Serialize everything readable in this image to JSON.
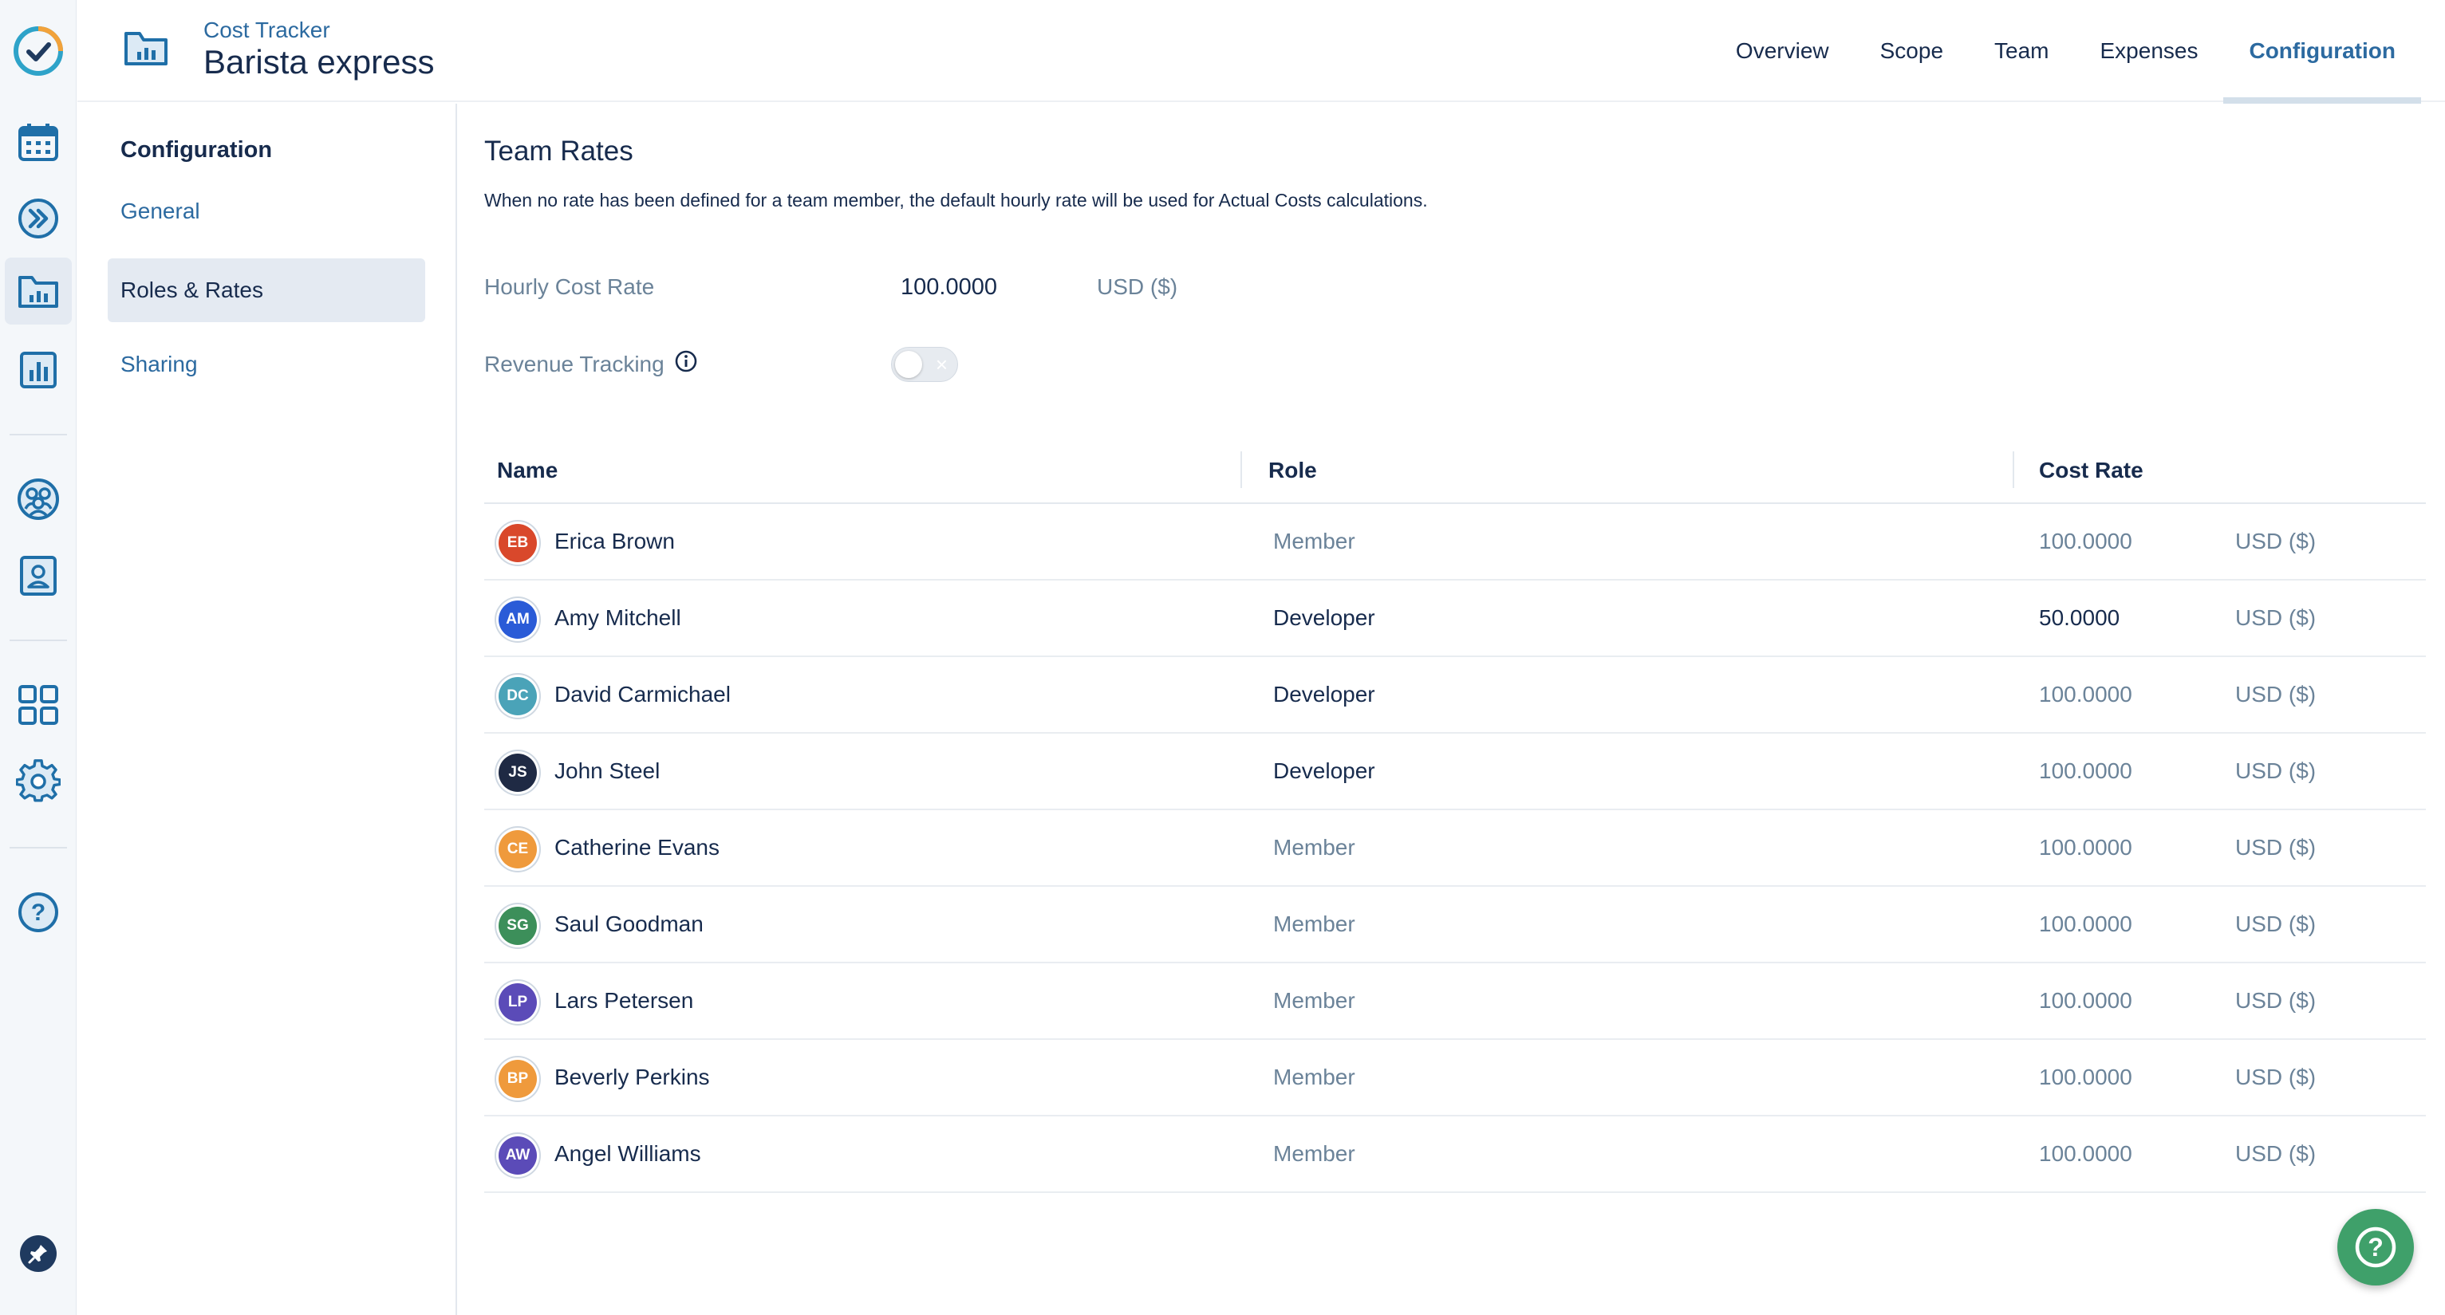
{
  "header": {
    "subtitle": "Cost Tracker",
    "title": "Barista express",
    "tabs": [
      {
        "label": "Overview",
        "active": false
      },
      {
        "label": "Scope",
        "active": false
      },
      {
        "label": "Team",
        "active": false
      },
      {
        "label": "Expenses",
        "active": false
      },
      {
        "label": "Configuration",
        "active": true
      }
    ]
  },
  "config_nav": {
    "heading": "Configuration",
    "items": [
      {
        "label": "General",
        "active": false
      },
      {
        "label": "Roles & Rates",
        "active": true
      },
      {
        "label": "Sharing",
        "active": false
      }
    ]
  },
  "team_rates": {
    "title": "Team Rates",
    "description": "When no rate has been defined for a team member, the default hourly rate will be used for Actual Costs calculations.",
    "hourly_cost_rate": {
      "label": "Hourly Cost Rate",
      "value": "100.0000",
      "currency": "USD ($)"
    },
    "revenue_tracking": {
      "label": "Revenue Tracking",
      "enabled": false
    }
  },
  "table": {
    "columns": {
      "name": "Name",
      "role": "Role",
      "cost_rate": "Cost Rate"
    },
    "rows": [
      {
        "initials": "EB",
        "avatar_color": "#d9482b",
        "name": "Erica Brown",
        "role": "Member",
        "role_custom": false,
        "rate": "100.0000",
        "rate_custom": false,
        "currency": "USD ($)"
      },
      {
        "initials": "AM",
        "avatar_color": "#2a5bd7",
        "name": "Amy Mitchell",
        "role": "Developer",
        "role_custom": true,
        "rate": "50.0000",
        "rate_custom": true,
        "currency": "USD ($)"
      },
      {
        "initials": "DC",
        "avatar_color": "#4aa3b8",
        "name": "David Carmichael",
        "role": "Developer",
        "role_custom": true,
        "rate": "100.0000",
        "rate_custom": false,
        "currency": "USD ($)"
      },
      {
        "initials": "JS",
        "avatar_color": "#1f2a44",
        "name": "John Steel",
        "role": "Developer",
        "role_custom": true,
        "rate": "100.0000",
        "rate_custom": false,
        "currency": "USD ($)"
      },
      {
        "initials": "CE",
        "avatar_color": "#ef9a3c",
        "name": "Catherine Evans",
        "role": "Member",
        "role_custom": false,
        "rate": "100.0000",
        "rate_custom": false,
        "currency": "USD ($)"
      },
      {
        "initials": "SG",
        "avatar_color": "#3c8f5a",
        "name": "Saul Goodman",
        "role": "Member",
        "role_custom": false,
        "rate": "100.0000",
        "rate_custom": false,
        "currency": "USD ($)"
      },
      {
        "initials": "LP",
        "avatar_color": "#5b4bb8",
        "name": "Lars Petersen",
        "role": "Member",
        "role_custom": false,
        "rate": "100.0000",
        "rate_custom": false,
        "currency": "USD ($)"
      },
      {
        "initials": "BP",
        "avatar_color": "#ef9a3c",
        "name": "Beverly Perkins",
        "role": "Member",
        "role_custom": false,
        "rate": "100.0000",
        "rate_custom": false,
        "currency": "USD ($)"
      },
      {
        "initials": "AW",
        "avatar_color": "#5b4bb8",
        "name": "Angel Williams",
        "role": "Member",
        "role_custom": false,
        "rate": "100.0000",
        "rate_custom": false,
        "currency": "USD ($)"
      }
    ]
  },
  "rail_icons": [
    "app-logo-icon",
    "calendar-icon",
    "forward-icon",
    "cost-tracker-icon",
    "reports-icon",
    "teams-icon",
    "contacts-icon",
    "apps-grid-icon",
    "settings-icon",
    "help-icon",
    "pin-icon"
  ],
  "colors": {
    "accent": "#2c6aa0",
    "text": "#172b4d",
    "muted": "#6b8399",
    "help_fab": "#3fa06a"
  }
}
